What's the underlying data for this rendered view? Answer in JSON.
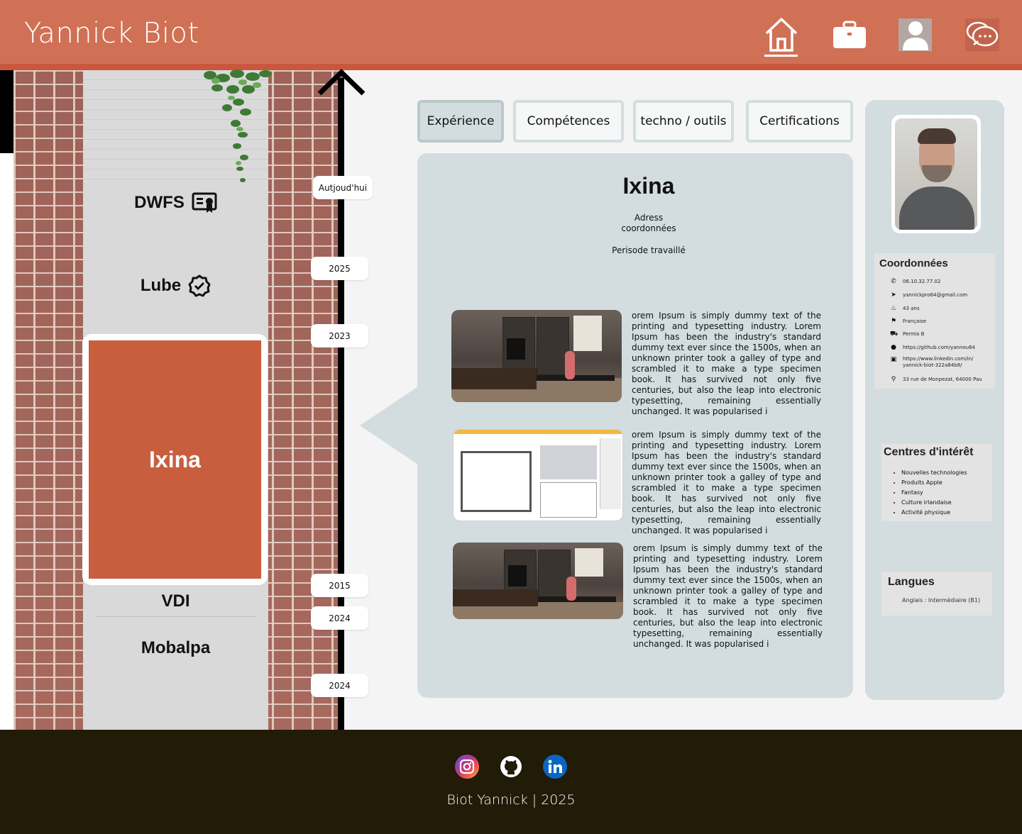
{
  "header": {
    "brand": "Yannick Biot",
    "nav": [
      {
        "name": "home-icon"
      },
      {
        "name": "briefcase-icon"
      },
      {
        "name": "user-icon"
      },
      {
        "name": "chat-icon"
      }
    ]
  },
  "timeline": {
    "items": [
      {
        "label": "DWFS",
        "icon": "certificate-icon"
      },
      {
        "label": "Lube",
        "icon": "verified-badge-icon"
      },
      {
        "label": "Ixina",
        "active": true
      },
      {
        "label": "VDI"
      },
      {
        "label": "Mobalpa"
      }
    ],
    "years": [
      "Autjoud'hui",
      "2025",
      "2023",
      "2015",
      "2024",
      "2024"
    ]
  },
  "tabs": [
    {
      "label": "Expérience",
      "active": true
    },
    {
      "label": "Compétences"
    },
    {
      "label": "techno / outils"
    },
    {
      "label": "Certifications"
    }
  ],
  "experience": {
    "title": "Ixina",
    "address_line1": "Adress",
    "address_line2": "coordonnées",
    "period": "Perisode travaillé",
    "paragraphs": [
      "orem Ipsum is simply dummy text of the printing and typesetting industry. Lorem Ipsum has been the industry's standard dummy text ever since the 1500s, when an unknown printer took a galley of type and scrambled it to make a type specimen book. It has survived not only five centuries, but also the leap into electronic typesetting, remaining essentially unchanged. It was popularised i",
      "orem Ipsum is simply dummy text of the printing and typesetting industry. Lorem Ipsum has been the industry's standard dummy text ever since the 1500s, when an unknown printer took a galley of type and scrambled it to make a type specimen book. It has survived not only five centuries, but also the leap into electronic typesetting, remaining essentially unchanged. It was popularised i",
      "orem Ipsum is simply dummy text of the printing and typesetting industry. Lorem Ipsum has been the industry's standard dummy text ever since the 1500s, when an unknown printer took a galley of type and scrambled it to make a type specimen book. It has survived not only five centuries, but also the leap into electronic typesetting, remaining essentially unchanged. It was popularised i"
    ]
  },
  "sidebar": {
    "coord_title": "Coordonnées",
    "coords": [
      {
        "icon": "phone-icon",
        "text": "06.10.32.77.02"
      },
      {
        "icon": "send-icon",
        "text": "yannickpro64@gmail.com"
      },
      {
        "icon": "cake-icon",
        "text": "43 ans"
      },
      {
        "icon": "flag-icon",
        "text": "Française"
      },
      {
        "icon": "car-icon",
        "text": "Permis B"
      },
      {
        "icon": "github-icon",
        "text": "https://github.com/yannou64"
      },
      {
        "icon": "linkedin-icon",
        "text": "https://www.linkedin.com/in/",
        "text2": "yannick-biot-322a84b8/"
      },
      {
        "icon": "location-icon",
        "text": "33 rue de Monpezat, 64000 Pau"
      }
    ],
    "interest_title": "Centres d'intérêt",
    "interests": [
      "Nouvelles technologies",
      "Produits Apple",
      "Fantasy",
      "Culture irlandaise",
      "Activité physique"
    ],
    "lang_title": "Langues",
    "lang_text": "Anglais : Intermédiaire (B1)"
  },
  "footer": {
    "copyright": "Biot Yannick | 2025"
  }
}
